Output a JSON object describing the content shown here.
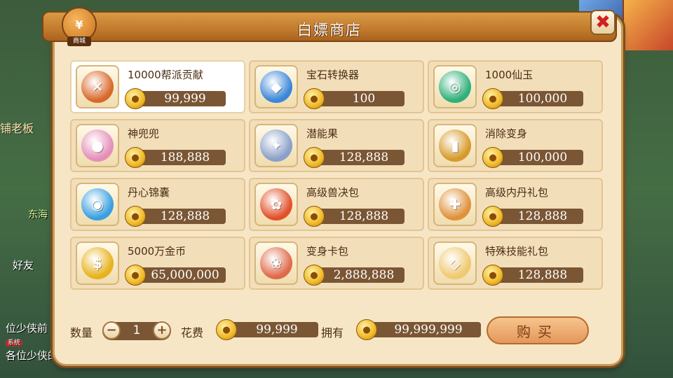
{
  "shop": {
    "title": "白嫖商店",
    "emblem_label": "商城",
    "close_symbol": "✖"
  },
  "background": {
    "npc_label": "铺老板",
    "npc2_label": "东海",
    "friend_label": "好友",
    "chat_line_1": "位少侠前",
    "chat_tag": "系统",
    "chat_line_2": "各位少侠的"
  },
  "items": [
    {
      "name": "10000帮派贡献",
      "price": "99,999",
      "icon": "guild-token-icon",
      "color": "#d9682a",
      "glyph": "✕",
      "selected": true
    },
    {
      "name": "宝石转换器",
      "price": "100",
      "icon": "gem-converter-icon",
      "color": "#3a86d8",
      "glyph": "◆"
    },
    {
      "name": "1000仙玉",
      "price": "100,000",
      "icon": "jade-icon",
      "color": "#2fb07a",
      "glyph": "◎"
    },
    {
      "name": "神兜兜",
      "price": "188,888",
      "icon": "pouch-pet-icon",
      "color": "#e58fb8",
      "glyph": "●"
    },
    {
      "name": "潜能果",
      "price": "128,888",
      "icon": "potential-fruit-icon",
      "color": "#8aa0c8",
      "glyph": "✦"
    },
    {
      "name": "消除变身",
      "price": "100,000",
      "icon": "card-icon",
      "color": "#d79a2a",
      "glyph": "▮"
    },
    {
      "name": "丹心锦囊",
      "price": "128,888",
      "icon": "orb-bag-icon",
      "color": "#3aa0e0",
      "glyph": "◉"
    },
    {
      "name": "高级兽决包",
      "price": "128,888",
      "icon": "beast-pack-icon",
      "color": "#e2502a",
      "glyph": "✿"
    },
    {
      "name": "高级内丹礼包",
      "price": "128,888",
      "icon": "elixir-pack-icon",
      "color": "#e0913a",
      "glyph": "✚"
    },
    {
      "name": "5000万金币",
      "price": "65,000,000",
      "icon": "gold-coin-icon",
      "color": "#e8b21e",
      "glyph": "$"
    },
    {
      "name": "变身卡包",
      "price": "2,888,888",
      "icon": "card-pack-icon",
      "color": "#e06a4a",
      "glyph": "❀"
    },
    {
      "name": "特殊技能礼包",
      "price": "128,888",
      "icon": "skill-egg-icon",
      "color": "#f0c870",
      "glyph": "◇"
    }
  ],
  "footer": {
    "qty_label": "数量",
    "qty_value": "1",
    "cost_label": "花费",
    "cost_value": "99,999",
    "own_label": "拥有",
    "own_value": "99,999,999",
    "buy_label": "购买",
    "minus": "−",
    "plus": "+"
  },
  "colors": {
    "panel_bg": "#f7e6c6",
    "title_bar": "#c27a2c",
    "price_bar": "#7a5634",
    "close_x": "#d21f1f"
  }
}
